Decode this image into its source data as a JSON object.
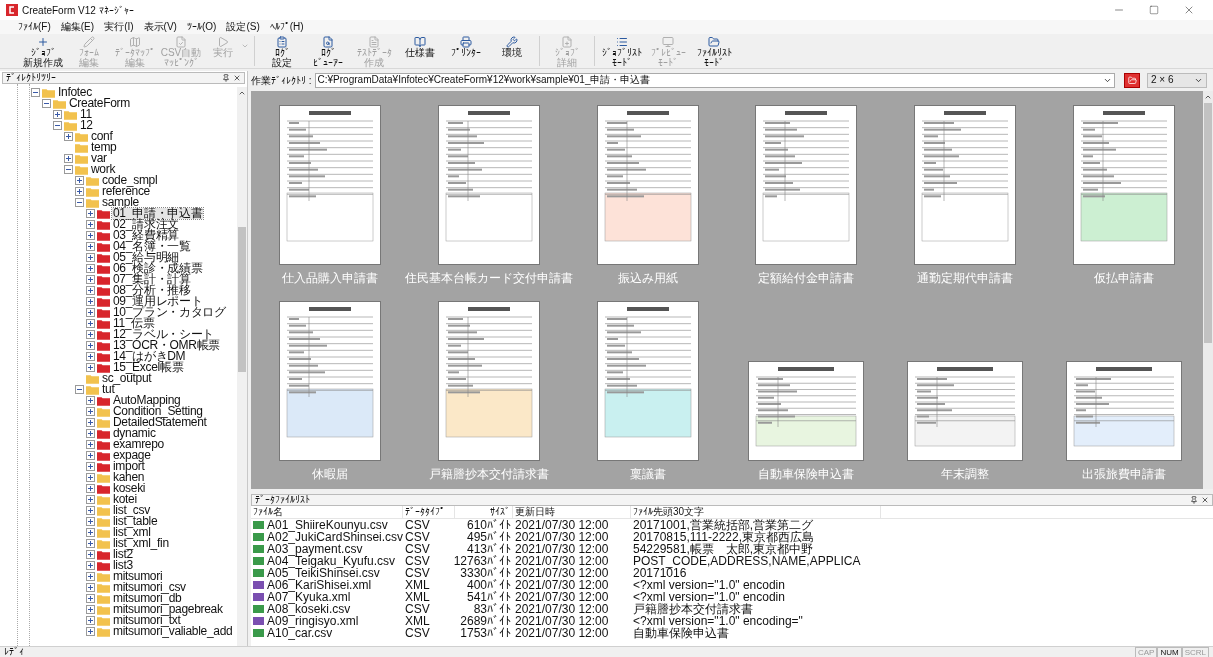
{
  "window": {
    "title": "CreateForm V12 ﾏﾈｰｼﾞｬｰ"
  },
  "menu": [
    "ﾌｧｲﾙ(F)",
    "編集(E)",
    "実行(I)",
    "表示(V)",
    "ﾂｰﾙ(O)",
    "設定(S)",
    "ﾍﾙﾌﾟ(H)"
  ],
  "toolbar": [
    {
      "lines": [
        "ｼﾞｮﾌﾞ",
        "新規作成"
      ],
      "disabled": false
    },
    {
      "lines": [
        "ﾌｫｰﾑ",
        "編集"
      ],
      "disabled": true
    },
    {
      "lines": [
        "ﾃﾞｰﾀﾏｯﾌﾟ",
        "編集"
      ],
      "disabled": true
    },
    {
      "lines": [
        "CSV自動",
        "ﾏｯﾋﾟﾝｸﾞ"
      ],
      "disabled": true
    },
    {
      "lines": [
        "実行"
      ],
      "disabled": true,
      "dropdown": true
    },
    {
      "lines": [
        "ﾛｸﾞ",
        "設定"
      ],
      "disabled": false,
      "separator_before": true
    },
    {
      "lines": [
        "ﾛｸﾞ",
        "ﾋﾞｭｰｱｰ"
      ],
      "disabled": false
    },
    {
      "lines": [
        "ﾃｽﾄﾃﾞｰﾀ",
        "作成"
      ],
      "disabled": true
    },
    {
      "lines": [
        "仕様書"
      ],
      "disabled": false
    },
    {
      "lines": [
        "ﾌﾟﾘﾝﾀｰ"
      ],
      "disabled": false
    },
    {
      "lines": [
        "環境"
      ],
      "disabled": false
    },
    {
      "lines": [
        "ｼﾞｮﾌﾞ",
        "詳細"
      ],
      "disabled": true,
      "separator_before": true
    },
    {
      "lines": [
        "ｼﾞｮﾌﾞﾘｽﾄ",
        "ﾓｰﾄﾞ"
      ],
      "disabled": false,
      "separator_before": true
    },
    {
      "lines": [
        "ﾌﾟﾚﾋﾞｭｰ",
        "ﾓｰﾄﾞ"
      ],
      "disabled": true
    },
    {
      "lines": [
        "ﾌｧｲﾙﾘｽﾄ",
        "ﾓｰﾄﾞ"
      ],
      "disabled": false
    }
  ],
  "directory_tree": {
    "title": "ﾃﾞｨﾚｸﾄﾘﾂﾘｰ",
    "items": [
      {
        "label": "Infotec",
        "expanded": true,
        "selected": false,
        "color": "#f2c24e",
        "children": [
          {
            "label": "CreateForm",
            "expanded": true,
            "selected": false,
            "color": "#f2c24e",
            "children": [
              {
                "label": "11",
                "expanded": false,
                "selected": false,
                "color": "#f2c24e"
              },
              {
                "label": "12",
                "expanded": true,
                "selected": false,
                "color": "#f2c24e",
                "children": [
                  {
                    "label": "conf",
                    "expanded": false,
                    "selected": false,
                    "color": "#f2c24e"
                  },
                  {
                    "label": "temp",
                    "selected": false,
                    "color": "#f2c24e"
                  },
                  {
                    "label": "var",
                    "expanded": false,
                    "selected": false,
                    "color": "#f2c24e"
                  },
                  {
                    "label": "work",
                    "expanded": true,
                    "selected": false,
                    "color": "#f2c24e",
                    "children": [
                      {
                        "label": "code_smpl",
                        "expanded": false,
                        "selected": false,
                        "color": "#f2c24e"
                      },
                      {
                        "label": "reference",
                        "expanded": false,
                        "selected": false,
                        "color": "#f2c24e"
                      },
                      {
                        "label": "sample",
                        "expanded": true,
                        "selected": false,
                        "color": "#f2c24e",
                        "children": [
                          {
                            "label": "01_申請・申込書",
                            "expanded": false,
                            "selected": true,
                            "color": "#d8262c"
                          },
                          {
                            "label": "02_請求注文",
                            "expanded": false,
                            "selected": false,
                            "color": "#d8262c"
                          },
                          {
                            "label": "03_経費精算",
                            "expanded": false,
                            "selected": false,
                            "color": "#d8262c"
                          },
                          {
                            "label": "04_名簿・一覧",
                            "expanded": false,
                            "selected": false,
                            "color": "#d8262c"
                          },
                          {
                            "label": "05_給与明細",
                            "expanded": false,
                            "selected": false,
                            "color": "#d8262c"
                          },
                          {
                            "label": "06_検診・成績票",
                            "expanded": false,
                            "selected": false,
                            "color": "#d8262c"
                          },
                          {
                            "label": "07_集計・計算",
                            "expanded": false,
                            "selected": false,
                            "color": "#d8262c"
                          },
                          {
                            "label": "08_分析・推移",
                            "expanded": false,
                            "selected": false,
                            "color": "#d8262c"
                          },
                          {
                            "label": "09_運用レポート",
                            "expanded": false,
                            "selected": false,
                            "color": "#d8262c"
                          },
                          {
                            "label": "10_プラン・カタログ",
                            "expanded": false,
                            "selected": false,
                            "color": "#d8262c"
                          },
                          {
                            "label": "11_伝票",
                            "expanded": false,
                            "selected": false,
                            "color": "#d8262c"
                          },
                          {
                            "label": "12_ラベル・シート",
                            "expanded": false,
                            "selected": false,
                            "color": "#d8262c"
                          },
                          {
                            "label": "13_OCR・OMR帳票",
                            "expanded": false,
                            "selected": false,
                            "color": "#d8262c"
                          },
                          {
                            "label": "14_はがきDM",
                            "expanded": false,
                            "selected": false,
                            "color": "#d8262c"
                          },
                          {
                            "label": "15_Excel帳票",
                            "expanded": false,
                            "selected": false,
                            "color": "#d8262c"
                          }
                        ]
                      },
                      {
                        "label": "sc_output",
                        "selected": false,
                        "color": "#f2c24e"
                      },
                      {
                        "label": "tut",
                        "expanded": true,
                        "selected": false,
                        "color": "#f2c24e",
                        "children": [
                          {
                            "label": "AutoMapping",
                            "expanded": false,
                            "selected": false,
                            "color": "#d8262c"
                          },
                          {
                            "label": "Condition_Setting",
                            "expanded": false,
                            "selected": false,
                            "color": "#f2c24e"
                          },
                          {
                            "label": "DetailedStatement",
                            "expanded": false,
                            "selected": false,
                            "color": "#f2c24e"
                          },
                          {
                            "label": "dynamic",
                            "expanded": false,
                            "selected": false,
                            "color": "#d8262c"
                          },
                          {
                            "label": "examrepo",
                            "expanded": false,
                            "selected": false,
                            "color": "#d8262c"
                          },
                          {
                            "label": "expage",
                            "expanded": false,
                            "selected": false,
                            "color": "#d8262c"
                          },
                          {
                            "label": "import",
                            "expanded": false,
                            "selected": false,
                            "color": "#d8262c"
                          },
                          {
                            "label": "kahen",
                            "expanded": false,
                            "selected": false,
                            "color": "#f2c24e"
                          },
                          {
                            "label": "koseki",
                            "expanded": false,
                            "selected": false,
                            "color": "#d8262c"
                          },
                          {
                            "label": "kotei",
                            "expanded": false,
                            "selected": false,
                            "color": "#f2c24e"
                          },
                          {
                            "label": "list_csv",
                            "expanded": false,
                            "selected": false,
                            "color": "#f2c24e"
                          },
                          {
                            "label": "list_table",
                            "expanded": false,
                            "selected": false,
                            "color": "#f2c24e"
                          },
                          {
                            "label": "list_xml",
                            "expanded": false,
                            "selected": false,
                            "color": "#f2c24e"
                          },
                          {
                            "label": "list_xml_fin",
                            "expanded": false,
                            "selected": false,
                            "color": "#f2c24e"
                          },
                          {
                            "label": "list2",
                            "expanded": false,
                            "selected": false,
                            "color": "#d8262c"
                          },
                          {
                            "label": "list3",
                            "expanded": false,
                            "selected": false,
                            "color": "#d8262c"
                          },
                          {
                            "label": "mitsumori",
                            "expanded": false,
                            "selected": false,
                            "color": "#f2c24e"
                          },
                          {
                            "label": "mitsumori_csv",
                            "expanded": false,
                            "selected": false,
                            "color": "#f2c24e"
                          },
                          {
                            "label": "mitsumori_db",
                            "expanded": false,
                            "selected": false,
                            "color": "#f2c24e"
                          },
                          {
                            "label": "mitsumori_pagebreak",
                            "expanded": false,
                            "selected": false,
                            "color": "#f2c24e"
                          },
                          {
                            "label": "mitsumori_txt",
                            "expanded": false,
                            "selected": false,
                            "color": "#f2c24e"
                          },
                          {
                            "label": "mitsumori_valiable_add",
                            "expanded": false,
                            "selected": false,
                            "color": "#f2c24e"
                          }
                        ]
                      }
                    ]
                  }
                ]
              }
            ]
          }
        ]
      }
    ]
  },
  "work_directory": {
    "label": "作業ﾃﾞｨﾚｸﾄﾘ :",
    "value": "C:¥ProgramData¥Infotec¥CreateForm¥12¥work¥sample¥01_申請・申込書",
    "layout": "2 × 6"
  },
  "thumbnails": [
    {
      "label": "仕入品購入申請書",
      "kind": "portrait"
    },
    {
      "label": "住民基本台帳カード交付申請書",
      "kind": "portrait"
    },
    {
      "label": "振込み用紙",
      "kind": "portrait"
    },
    {
      "label": "定額給付金申請書",
      "kind": "portrait"
    },
    {
      "label": "通勤定期代申請書",
      "kind": "portrait"
    },
    {
      "label": "仮払申請書",
      "kind": "portrait"
    },
    {
      "label": "休暇届",
      "kind": "portrait"
    },
    {
      "label": "戸籍謄抄本交付請求書",
      "kind": "portrait"
    },
    {
      "label": "稟議書",
      "kind": "portrait"
    },
    {
      "label": "自動車保険申込書",
      "kind": "landscape"
    },
    {
      "label": "年末調整",
      "kind": "landscape"
    },
    {
      "label": "出張旅費申請書",
      "kind": "landscape"
    }
  ],
  "data_file_list": {
    "title": "ﾃﾞｰﾀﾌｧｲﾙﾘｽﾄ",
    "columns": [
      "ﾌｧｲﾙ名",
      "ﾃﾞｰﾀﾀｲﾌﾟ",
      "ｻｲｽﾞ",
      "更新日時",
      "ﾌｧｲﾙ先頭30文字"
    ],
    "rows": [
      {
        "kind": "csv",
        "cells": [
          "A01_ShiireKounyu.csv",
          "CSV",
          "610ﾊﾞｲﾄ",
          "2021/07/30 12:00",
          "20171001,営業統括部,営業第二グ"
        ]
      },
      {
        "kind": "csv",
        "cells": [
          "A02_JukiCardShinsei.csv",
          "CSV",
          "495ﾊﾞｲﾄ",
          "2021/07/30 12:00",
          "20170815,111-2222,東京都西広島"
        ]
      },
      {
        "kind": "csv",
        "cells": [
          "A03_payment.csv",
          "CSV",
          "413ﾊﾞｲﾄ",
          "2021/07/30 12:00",
          "54229581,帳票　太郎,東京都中野"
        ]
      },
      {
        "kind": "csv",
        "cells": [
          "A04_Teigaku_Kyufu.csv",
          "CSV",
          "12763ﾊﾞｲﾄ",
          "2021/07/30 12:00",
          "POST_CODE,ADDRESS,NAME,APPLICA"
        ]
      },
      {
        "kind": "csv",
        "cells": [
          "A05_TeikiShinsei.csv",
          "CSV",
          "3330ﾊﾞｲﾄ",
          "2021/07/30 12:00",
          "20171016"
        ]
      },
      {
        "kind": "xml",
        "cells": [
          "A06_KariShisei.xml",
          "XML",
          "400ﾊﾞｲﾄ",
          "2021/07/30 12:00",
          "<?xml version=\"1.0\" encodin"
        ]
      },
      {
        "kind": "xml",
        "cells": [
          "A07_Kyuka.xml",
          "XML",
          "541ﾊﾞｲﾄ",
          "2021/07/30 12:00",
          "<?xml version=\"1.0\" encodin"
        ]
      },
      {
        "kind": "csv",
        "cells": [
          "A08_koseki.csv",
          "CSV",
          "83ﾊﾞｲﾄ",
          "2021/07/30 12:00",
          "戸籍謄抄本交付請求書"
        ]
      },
      {
        "kind": "xml",
        "cells": [
          "A09_ringisyo.xml",
          "XML",
          "2689ﾊﾞｲﾄ",
          "2021/07/30 12:00",
          "<?xml version=\"1.0\" encoding=\""
        ]
      },
      {
        "kind": "csv",
        "cells": [
          "A10_car.csv",
          "CSV",
          "1753ﾊﾞｲﾄ",
          "2021/07/30 12:00",
          "自動車保険申込書"
        ]
      }
    ]
  },
  "status_bar": {
    "text": "ﾚﾃﾞｨ",
    "indicators": [
      {
        "label": "CAP",
        "on": false
      },
      {
        "label": "NUM",
        "on": true
      },
      {
        "label": "SCRL",
        "on": false
      }
    ]
  }
}
